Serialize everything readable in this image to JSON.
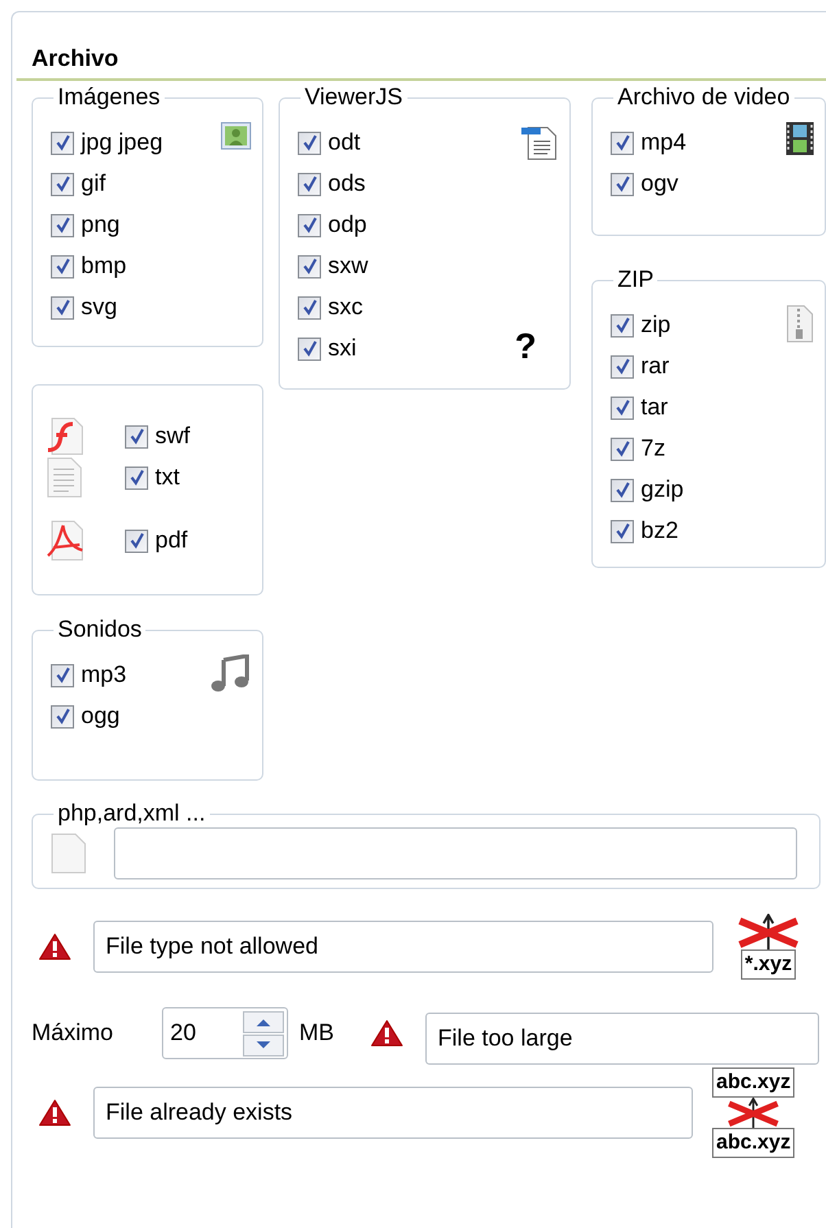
{
  "title": "Archivo",
  "columns": [
    [
      {
        "kind": "images",
        "legend": "Imágenes",
        "items": [
          {
            "label": "jpg jpeg",
            "checked": true
          },
          {
            "label": "gif",
            "checked": true
          },
          {
            "label": "png",
            "checked": true
          },
          {
            "label": "bmp",
            "checked": true
          },
          {
            "label": "svg",
            "checked": true
          }
        ]
      },
      {
        "kind": "documents",
        "items": [
          {
            "kind": "flash",
            "label": "swf",
            "checked": true
          },
          {
            "kind": "text",
            "label": "txt",
            "checked": true
          },
          {
            "kind": "pdf",
            "label": "pdf",
            "checked": true
          }
        ]
      },
      {
        "kind": "sounds",
        "legend": "Sonidos",
        "items": [
          {
            "label": "mp3",
            "checked": true
          },
          {
            "label": "ogg",
            "checked": true
          }
        ]
      }
    ],
    [
      {
        "kind": "viewer",
        "legend": "ViewerJS",
        "help": "?",
        "items": [
          {
            "label": "odt",
            "checked": true
          },
          {
            "label": "ods",
            "checked": true
          },
          {
            "label": "odp",
            "checked": true
          },
          {
            "label": "sxw",
            "checked": true
          },
          {
            "label": "sxc",
            "checked": true
          },
          {
            "label": "sxi",
            "checked": true
          }
        ]
      }
    ],
    [
      {
        "kind": "video",
        "legend": "Archivo de video",
        "items": [
          {
            "label": "mp4",
            "checked": true
          },
          {
            "label": "ogv",
            "checked": true
          }
        ]
      },
      {
        "kind": "zip",
        "legend": "ZIP",
        "items": [
          {
            "label": "zip",
            "checked": true
          },
          {
            "label": "rar",
            "checked": true
          },
          {
            "label": "tar",
            "checked": true
          },
          {
            "label": "7z",
            "checked": true
          },
          {
            "label": "gzip",
            "checked": true
          },
          {
            "label": "bz2",
            "checked": true
          }
        ]
      }
    ]
  ],
  "other_types": {
    "legend": "php,ard,xml ..."
  },
  "type_not_allowed": {
    "message": "File type not allowed",
    "badge": "*.xyz"
  },
  "max_size": {
    "label": "Máximo",
    "value": "20",
    "unit": "MB",
    "message": "File too large"
  },
  "already_exists": {
    "message": "File already exists",
    "badge_top": "abc.xyz",
    "badge_bottom": "abc.xyz"
  }
}
